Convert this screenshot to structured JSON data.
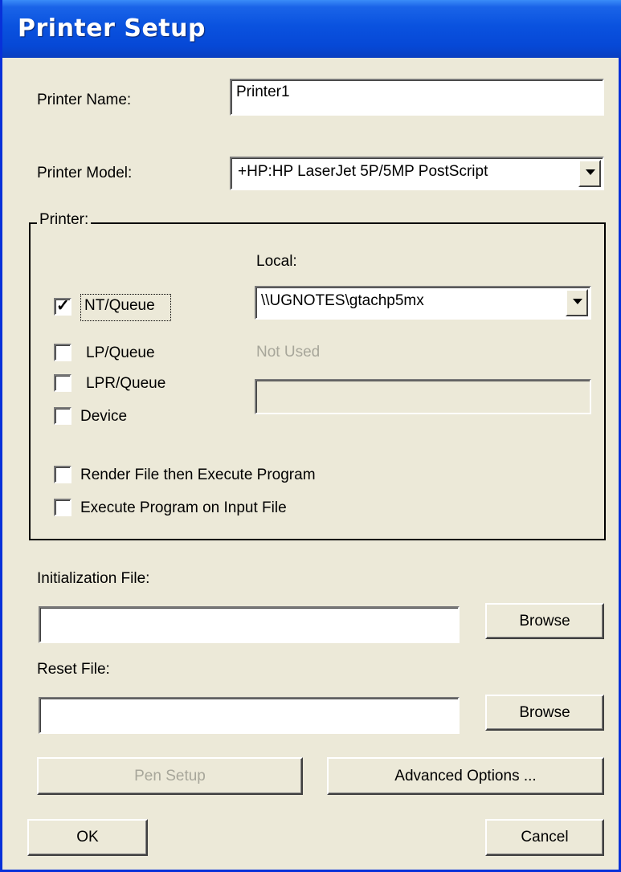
{
  "window": {
    "title": "Printer Setup"
  },
  "printer_name": {
    "label": "Printer Name:",
    "value": "Printer1"
  },
  "printer_model": {
    "label": "Printer Model:",
    "value": "+HP:HP LaserJet 5P/5MP PostScript"
  },
  "printer_group": {
    "legend": "Printer:",
    "local_label": "Local:",
    "local_value": "\\\\UGNOTES\\gtachp5mx",
    "not_used_label": "Not Used",
    "not_used_value": "",
    "options": [
      {
        "label": "NT/Queue",
        "checked": true
      },
      {
        "label": "LP/Queue",
        "checked": false
      },
      {
        "label": "LPR/Queue",
        "checked": false
      },
      {
        "label": "Device",
        "checked": false
      },
      {
        "label": "Render File then Execute Program",
        "checked": false
      },
      {
        "label": "Execute Program on Input File",
        "checked": false
      }
    ],
    "check_mark": "✓"
  },
  "init_file": {
    "label": "Initialization File:",
    "value": "",
    "browse_label": "Browse"
  },
  "reset_file": {
    "label": "Reset File:",
    "value": "",
    "browse_label": "Browse"
  },
  "buttons": {
    "pen_setup": "Pen Setup",
    "advanced": "Advanced Options ...",
    "ok": "OK",
    "cancel": "Cancel"
  },
  "colors": {
    "titlebar": "#0a52df",
    "face": "#ece9d8",
    "disabled_text": "#a7a69a"
  }
}
